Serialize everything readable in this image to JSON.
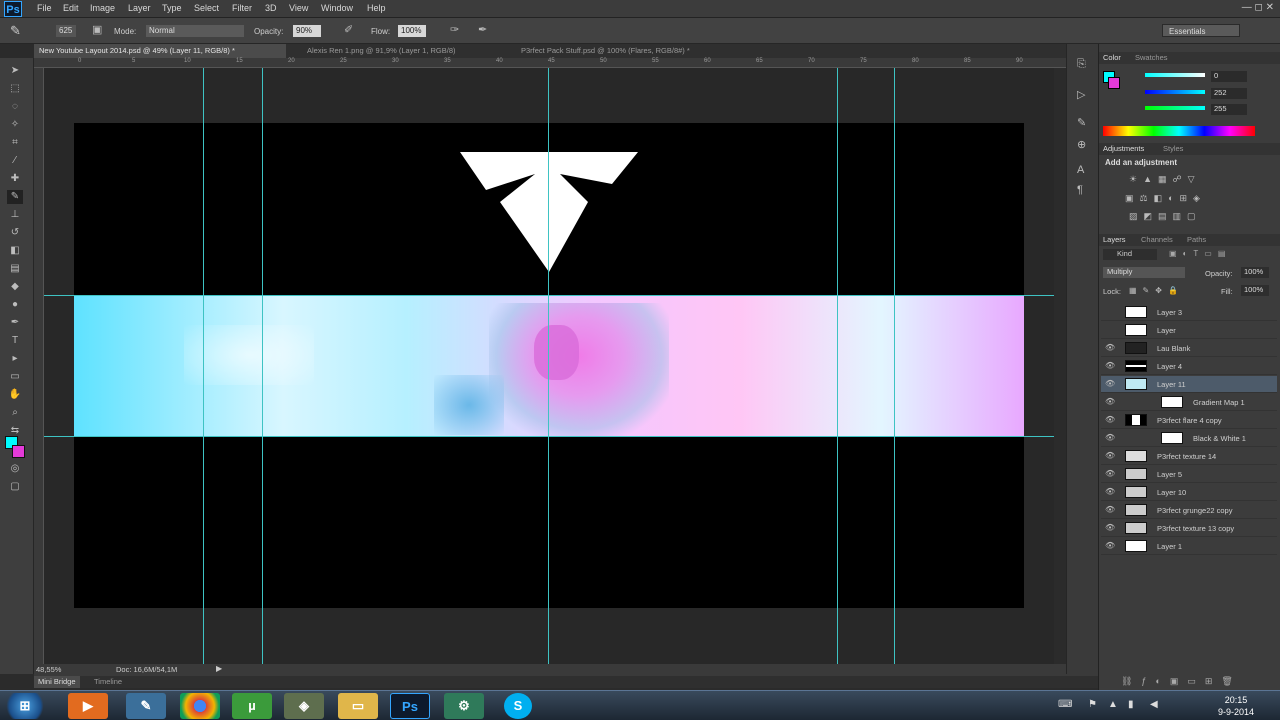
{
  "menubar": {
    "app_icon": "Ps",
    "items": [
      "File",
      "Edit",
      "Image",
      "Layer",
      "Type",
      "Select",
      "Filter",
      "3D",
      "View",
      "Window",
      "Help"
    ],
    "window_controls": "— ◻ ✕"
  },
  "options_bar": {
    "brush_size": "625",
    "mode_label": "Mode:",
    "mode_value": "Normal",
    "opacity_label": "Opacity:",
    "opacity_value": "90%",
    "flow_label": "Flow:",
    "flow_value": "100%",
    "workspace": "Essentials"
  },
  "tabs": [
    "New Youtube Layout 2014.psd @ 49% (Layer 11, RGB/8) *",
    "Alexis Ren 1.png @ 91,9% (Layer 1, RGB/8)",
    "P3rfect Pack Stuff.psd @ 100% (Flares, RGB/8#) *"
  ],
  "ruler_top": [
    "0",
    "5",
    "10",
    "15",
    "20",
    "25",
    "30",
    "35",
    "40",
    "45",
    "50",
    "55",
    "60",
    "65",
    "70",
    "75",
    "80",
    "85",
    "90",
    "95"
  ],
  "status": {
    "zoom": "48,55%",
    "doc_size": "Doc: 16,6M/54,1M"
  },
  "mini_tabs": [
    "Mini Bridge",
    "Timeline"
  ],
  "color_panel": {
    "tabs": [
      "Color",
      "Swatches"
    ],
    "r": "0",
    "g": "252",
    "b": "255"
  },
  "adjustments_panel": {
    "tabs": [
      "Adjustments",
      "Styles"
    ],
    "heading": "Add an adjustment"
  },
  "layers_panel": {
    "tabs": [
      "Layers",
      "Channels",
      "Paths"
    ],
    "kind": "Kind",
    "blend_mode": "Multiply",
    "opacity_label": "Opacity:",
    "opacity_value": "100%",
    "lock_label": "Lock:",
    "fill_label": "Fill:",
    "fill_value": "100%",
    "layers": [
      {
        "name": "Layer 3",
        "visible": false,
        "selected": false
      },
      {
        "name": "Layer",
        "visible": false,
        "selected": false
      },
      {
        "name": "Lau Blank",
        "visible": true,
        "selected": false
      },
      {
        "name": "Layer 4",
        "visible": true,
        "selected": false
      },
      {
        "name": "Layer 11",
        "visible": true,
        "selected": true
      },
      {
        "name": "Gradient Map 1",
        "visible": true,
        "selected": false
      },
      {
        "name": "P3rfect flare 4 copy",
        "visible": true,
        "selected": false
      },
      {
        "name": "Black & White 1",
        "visible": true,
        "selected": false
      },
      {
        "name": "P3rfect texture 14",
        "visible": true,
        "selected": false
      },
      {
        "name": "Layer 5",
        "visible": true,
        "selected": false
      },
      {
        "name": "Layer 10",
        "visible": true,
        "selected": false
      },
      {
        "name": "P3rfect grunge22 copy",
        "visible": true,
        "selected": false
      },
      {
        "name": "P3rfect texture 13 copy",
        "visible": true,
        "selected": false
      },
      {
        "name": "Layer 1",
        "visible": true,
        "selected": false
      }
    ]
  },
  "taskbar": {
    "buttons": [
      "start-orb",
      "media-player",
      "notepad",
      "chrome",
      "utorrent",
      "misc-app",
      "file-explorer",
      "photoshop",
      "network-app",
      "skype"
    ],
    "time": "20:15",
    "date": "9-9-2014"
  },
  "colors": {
    "foreground": "#00fcff",
    "background": "#e43ad8",
    "guide": "#3ec3c3"
  }
}
